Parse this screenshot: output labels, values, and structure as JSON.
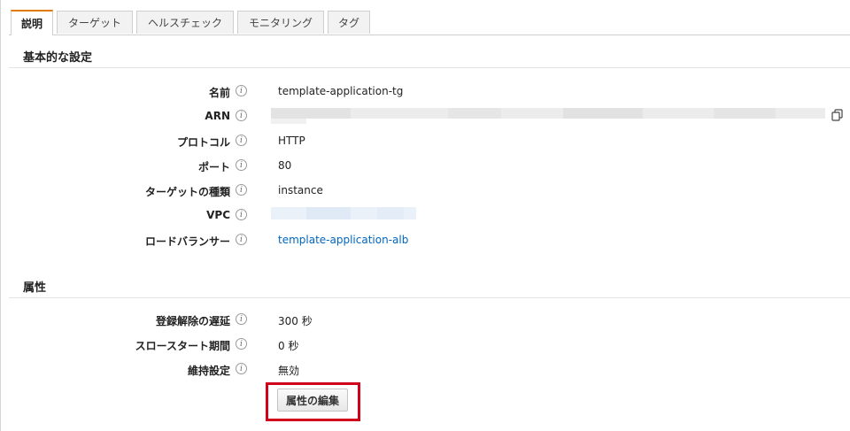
{
  "tabs": [
    {
      "label": "説明",
      "active": true
    },
    {
      "label": "ターゲット",
      "active": false
    },
    {
      "label": "ヘルスチェック",
      "active": false
    },
    {
      "label": "モニタリング",
      "active": false
    },
    {
      "label": "タグ",
      "active": false
    }
  ],
  "basic": {
    "title": "基本的な設定",
    "rows": [
      {
        "label": "名前",
        "value": "template-application-tg"
      },
      {
        "label": "ARN",
        "value": ""
      },
      {
        "label": "プロトコル",
        "value": "HTTP"
      },
      {
        "label": "ポート",
        "value": "80"
      },
      {
        "label": "ターゲットの種類",
        "value": "instance"
      },
      {
        "label": "VPC",
        "value": ""
      },
      {
        "label": "ロードバランサー",
        "value": "template-application-alb"
      }
    ]
  },
  "attributes": {
    "title": "属性",
    "rows": [
      {
        "label": "登録解除の遅延",
        "value": "300 秒"
      },
      {
        "label": "スロースタート期間",
        "value": "0 秒"
      },
      {
        "label": "維持設定",
        "value": "無効"
      }
    ],
    "edit_button_label": "属性の編集"
  },
  "info_icon_glyph": "i",
  "colors": {
    "accent_tab": "#e07b00",
    "link": "#0066c0",
    "highlight": "#d0021b"
  }
}
